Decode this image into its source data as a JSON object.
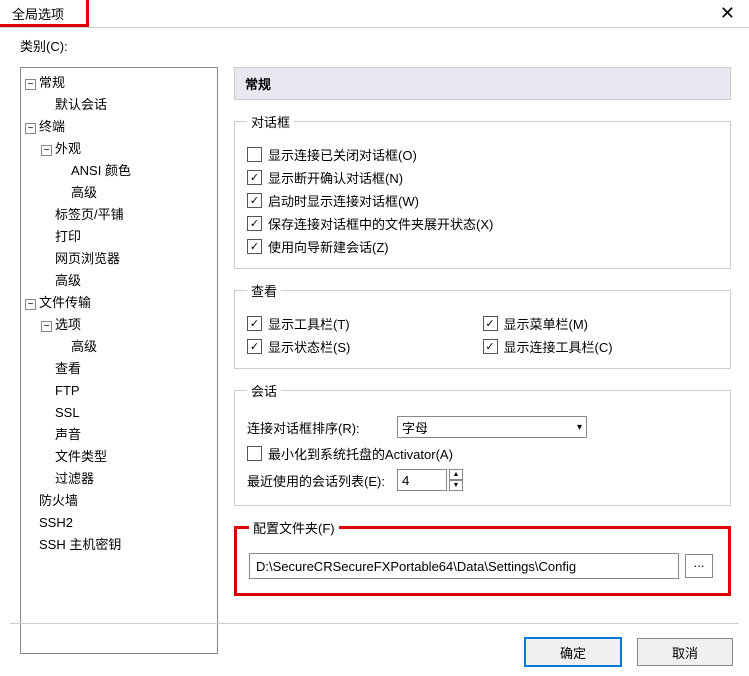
{
  "window": {
    "title": "全局选项"
  },
  "categoryLabel": "类别(C):",
  "tree": {
    "n0": "常规",
    "n0_0": "默认会话",
    "n1": "终端",
    "n1_0": "外观",
    "n1_0_0": "ANSI 颜色",
    "n1_0_1": "高级",
    "n1_1": "标签页/平铺",
    "n1_2": "打印",
    "n1_3": "网页浏览器",
    "n1_4": "高级",
    "n2": "文件传输",
    "n2_0": "选项",
    "n2_0_0": "高级",
    "n2_1": "查看",
    "n2_2": "FTP",
    "n2_3": "SSL",
    "n2_4": "声音",
    "n2_5": "文件类型",
    "n2_6": "过滤器",
    "n3": "防火墙",
    "n4": "SSH2",
    "n5": "SSH 主机密钥"
  },
  "panelTitle": "常规",
  "dialogGroup": {
    "legend": "对话框",
    "c0": "显示连接已关闭对话框(O)",
    "c1": "显示断开确认对话框(N)",
    "c2": "启动时显示连接对话框(W)",
    "c3": "保存连接对话框中的文件夹展开状态(X)",
    "c4": "使用向导新建会话(Z)"
  },
  "viewGroup": {
    "legend": "查看",
    "c0": "显示工具栏(T)",
    "c1": "显示菜单栏(M)",
    "c2": "显示状态栏(S)",
    "c3": "显示连接工具栏(C)"
  },
  "sessionGroup": {
    "legend": "会话",
    "sortLabel": "连接对话框排序(R):",
    "sortValue": "字母",
    "minTray": "最小化到系统托盘的Activator(A)",
    "recentLabel": "最近使用的会话列表(E):",
    "recentValue": "4"
  },
  "configGroup": {
    "legend": "配置文件夹(F)",
    "path": "D:\\SecureCRSecureFXPortable64\\Data\\Settings\\Config",
    "browse": "..."
  },
  "buttons": {
    "ok": "确定",
    "cancel": "取消"
  }
}
